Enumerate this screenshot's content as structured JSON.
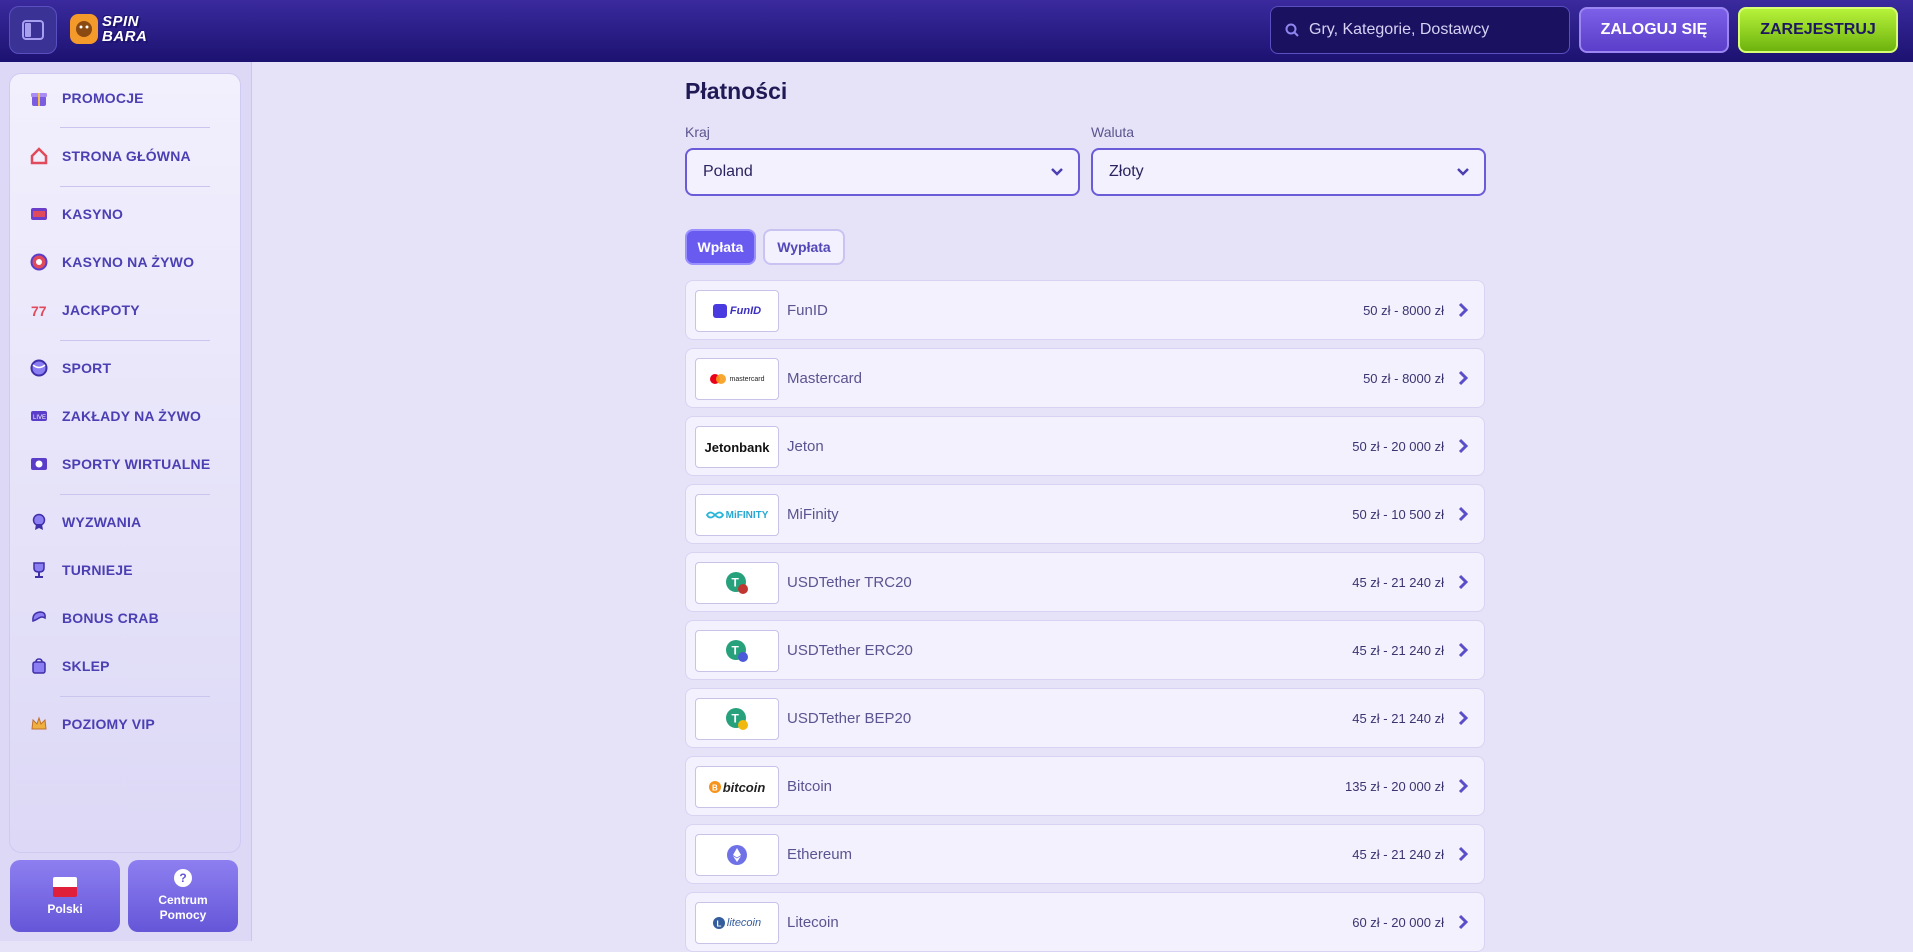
{
  "header": {
    "logo_line1": "SPIN",
    "logo_line2": "BARA",
    "search_placeholder": "Gry, Kategorie, Dostawcy",
    "login_label": "ZALOGUJ SIĘ",
    "register_label": "ZAREJESTRUJ"
  },
  "sidebar": {
    "items": [
      {
        "label": "PROMOCJE",
        "icon": "gift-icon"
      },
      {
        "label": "STRONA GŁÓWNA",
        "icon": "home-icon"
      },
      {
        "label": "KASYNO",
        "icon": "slot-machine-icon"
      },
      {
        "label": "KASYNO NA ŻYWO",
        "icon": "roulette-icon"
      },
      {
        "label": "JACKPOTY",
        "icon": "jackpot-icon"
      },
      {
        "label": "SPORT",
        "icon": "ball-icon"
      },
      {
        "label": "ZAKŁADY NA ŻYWO",
        "icon": "live-ticket-icon"
      },
      {
        "label": "SPORTY WIRTUALNE",
        "icon": "virtual-sports-icon"
      },
      {
        "label": "WYZWANIA",
        "icon": "medal-icon"
      },
      {
        "label": "TURNIEJE",
        "icon": "trophy-icon"
      },
      {
        "label": "BONUS CRAB",
        "icon": "crab-claw-icon"
      },
      {
        "label": "SKLEP",
        "icon": "shop-bag-icon"
      },
      {
        "label": "POZIOMY VIP",
        "icon": "crown-icon"
      }
    ],
    "language_label": "Polski",
    "help_line1": "Centrum",
    "help_line2": "Pomocy"
  },
  "main": {
    "title": "Płatności",
    "country_label": "Kraj",
    "country_value": "Poland",
    "currency_label": "Waluta",
    "currency_value": "Złoty",
    "tabs": [
      {
        "label": "Wpłata",
        "active": true
      },
      {
        "label": "Wypłata",
        "active": false
      }
    ],
    "payment_methods": [
      {
        "name": "FunID",
        "range": "50 zł - 8000 zł",
        "logo_text": "FunID"
      },
      {
        "name": "Mastercard",
        "range": "50 zł - 8000 zł",
        "logo_text": "mastercard"
      },
      {
        "name": "Jeton",
        "range": "50 zł - 20 000 zł",
        "logo_text": "Jetonbank"
      },
      {
        "name": "MiFinity",
        "range": "50 zł - 10 500 zł",
        "logo_text": "MiFINITY"
      },
      {
        "name": "USDTether TRC20",
        "range": "45 zł - 21 240 zł",
        "logo_text": ""
      },
      {
        "name": "USDTether ERC20",
        "range": "45 zł - 21 240 zł",
        "logo_text": ""
      },
      {
        "name": "USDTether BEP20",
        "range": "45 zł - 21 240 zł",
        "logo_text": ""
      },
      {
        "name": "Bitcoin",
        "range": "135 zł - 20 000 zł",
        "logo_text": "bitcoin"
      },
      {
        "name": "Ethereum",
        "range": "45 zł - 21 240 zł",
        "logo_text": ""
      },
      {
        "name": "Litecoin",
        "range": "60 zł - 20 000 zł",
        "logo_text": "litecoin"
      }
    ]
  },
  "colors": {
    "header": "#1c1270",
    "accent": "#6a5bf0",
    "register": "#8bd11c",
    "sidebar_text": "#4b3fb3"
  }
}
